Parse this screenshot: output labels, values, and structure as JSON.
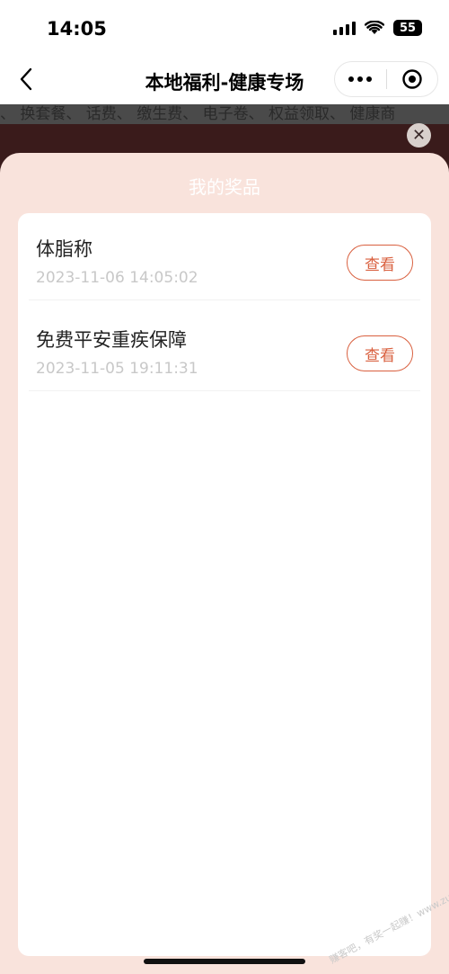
{
  "status_bar": {
    "time": "14:05",
    "battery": "55"
  },
  "nav": {
    "title": "本地福利-健康专场"
  },
  "background": {
    "partial_text": "、 换套餐、 话费、 缴生费、 电子卷、 权益领取、 健康商"
  },
  "sheet": {
    "title": "我的奖品",
    "prizes": [
      {
        "name": "体脂称",
        "date": "2023-11-06 14:05:02",
        "button_label": "查看"
      },
      {
        "name": "免费平安重疾保障",
        "date": "2023-11-05 19:11:31",
        "button_label": "查看"
      }
    ]
  },
  "watermark": "赚客吧，有奖一起赚！www.zuanke8.com",
  "colors": {
    "accent": "#d9603f",
    "sheet_bg": "#f9e3dc"
  }
}
